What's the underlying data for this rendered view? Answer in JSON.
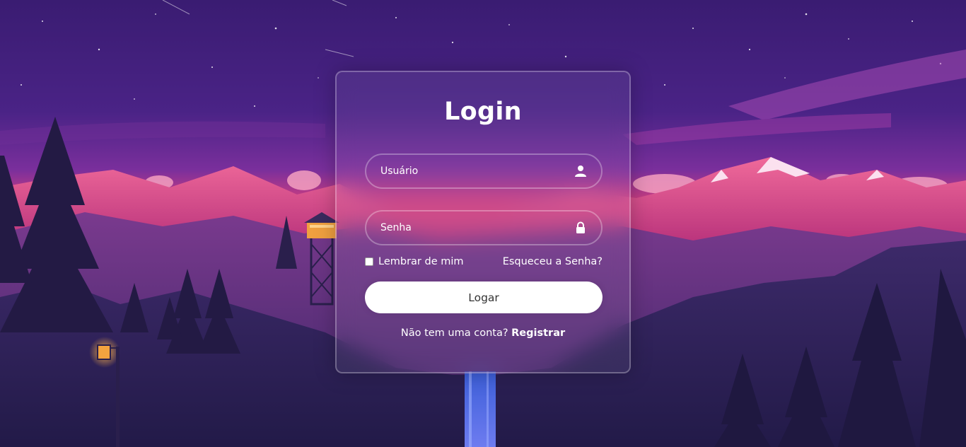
{
  "colors": {
    "sky_top": "#3a1c72",
    "sky_mid": "#7b2f9e",
    "horizon": "#e2407e",
    "mountain_pink": "#c8357a",
    "mountain_dark": "#2a1a4e",
    "card_border": "rgba(255,255,255,0.28)",
    "button_bg": "#ffffff",
    "button_text": "#333333"
  },
  "login": {
    "title": "Login",
    "username": {
      "placeholder": "Usuário",
      "icon": "user-icon"
    },
    "password": {
      "placeholder": "Senha",
      "icon": "lock-icon"
    },
    "remember_label": "Lembrar de mim",
    "forgot_link": "Esqueceu a Senha?",
    "submit_label": "Logar",
    "register_prompt": "Não tem uma conta?",
    "register_link": "Registrar"
  },
  "scene": {
    "moon_icon": "crescent-moon-icon"
  }
}
